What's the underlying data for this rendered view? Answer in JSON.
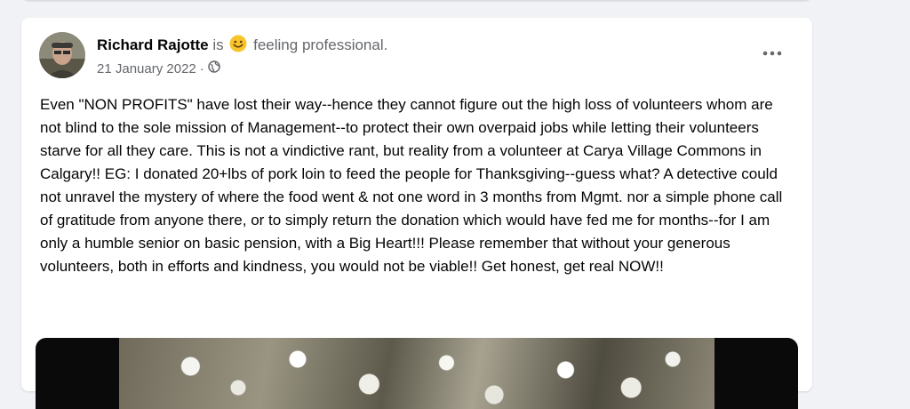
{
  "post": {
    "author": "Richard Rajotte",
    "is_text": "is",
    "feeling_emoji": "smiley-emoji",
    "feeling_text": "feeling professional.",
    "date": "21 January 2022",
    "separator": "·",
    "privacy_icon": "globe-icon",
    "more_icon": "more-options-icon",
    "body": "Even \"NON PROFITS\" have lost their way--hence they cannot figure out the high loss of volunteers whom are not blind to the sole mission of Management--to protect their own overpaid jobs while letting their volunteers starve for all they care. This is not a vindictive rant, but reality from a volunteer at Carya Village Commons in Calgary!! EG: I donated 20+lbs of pork loin to feed the people for Thanksgiving--guess what? A detective could not unravel the mystery of where the food went & not one word in 3 months from Mgmt. nor a simple phone call of gratitude from anyone there, or to simply return the donation which would have fed me for months--for I am only a humble senior on basic pension, with a Big Heart!!! Please remember that without your generous volunteers, both in efforts and kindness, you would not be viable!! Get honest, get real NOW!!"
  },
  "colors": {
    "page_bg": "#f0f2f5",
    "card_bg": "#ffffff",
    "primary_text": "#050505",
    "secondary_text": "#65676b",
    "emoji_yellow": "#f7c52b"
  }
}
